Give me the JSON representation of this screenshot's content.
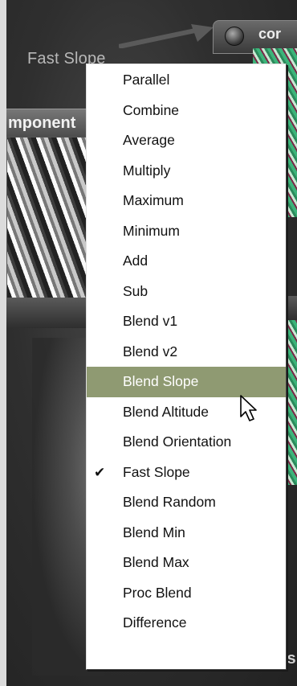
{
  "background": {
    "left_node_label": "Fast Slope",
    "top_node_label": "cor",
    "component_header_label": "mponent",
    "bottom_fragment": "is"
  },
  "menu": {
    "items": [
      {
        "label": "Parallel",
        "checked": false,
        "highlighted": false
      },
      {
        "label": "Combine",
        "checked": false,
        "highlighted": false
      },
      {
        "label": "Average",
        "checked": false,
        "highlighted": false
      },
      {
        "label": "Multiply",
        "checked": false,
        "highlighted": false
      },
      {
        "label": "Maximum",
        "checked": false,
        "highlighted": false
      },
      {
        "label": "Minimum",
        "checked": false,
        "highlighted": false
      },
      {
        "label": "Add",
        "checked": false,
        "highlighted": false
      },
      {
        "label": "Sub",
        "checked": false,
        "highlighted": false
      },
      {
        "label": "Blend v1",
        "checked": false,
        "highlighted": false
      },
      {
        "label": "Blend v2",
        "checked": false,
        "highlighted": false
      },
      {
        "label": "Blend Slope",
        "checked": false,
        "highlighted": true
      },
      {
        "label": "Blend Altitude",
        "checked": false,
        "highlighted": false
      },
      {
        "label": "Blend Orientation",
        "checked": false,
        "highlighted": false
      },
      {
        "label": "Fast Slope",
        "checked": true,
        "highlighted": false
      },
      {
        "label": "Blend Random",
        "checked": false,
        "highlighted": false
      },
      {
        "label": "Blend Min",
        "checked": false,
        "highlighted": false
      },
      {
        "label": "Blend Max",
        "checked": false,
        "highlighted": false
      },
      {
        "label": "Proc Blend",
        "checked": false,
        "highlighted": false
      },
      {
        "label": "Difference",
        "checked": false,
        "highlighted": false
      }
    ],
    "check_glyph": "✔",
    "highlight_color": "#8f9a72"
  }
}
